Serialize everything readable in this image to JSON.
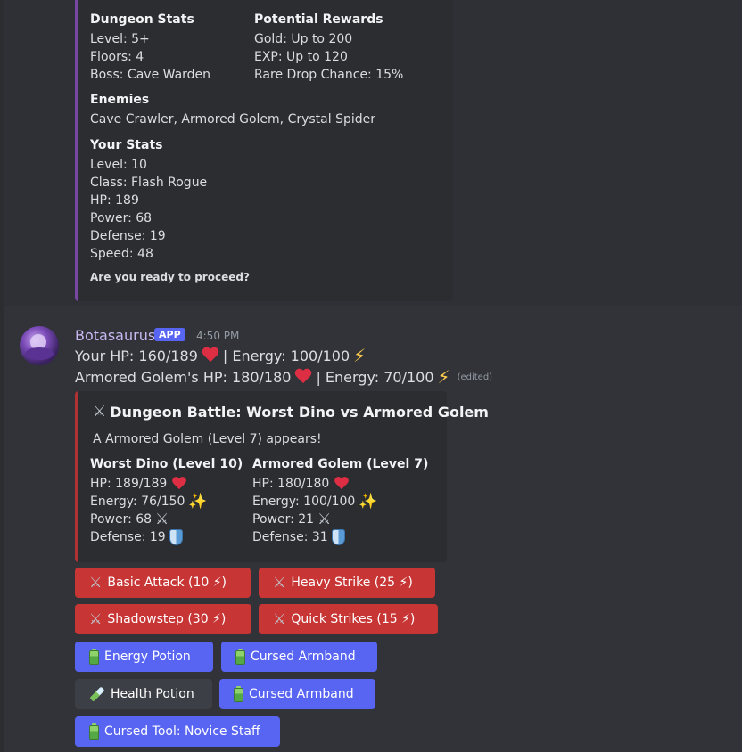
{
  "top_embed": {
    "clipped_text": "Dungeon Stats",
    "dungeon_stats": {
      "title": "Dungeon Stats",
      "lines": [
        "Level: 5+",
        "Floors: 4",
        "Boss: Cave Warden"
      ]
    },
    "rewards": {
      "title": "Potential Rewards",
      "lines": [
        "Gold: Up to 200",
        "EXP: Up to 120",
        "Rare Drop Chance: 15%"
      ]
    },
    "enemies": {
      "title": "Enemies",
      "text": "Cave Crawler, Armored Golem, Crystal Spider"
    },
    "your_stats": {
      "title": "Your Stats",
      "lines": [
        "Level: 10",
        "Class: Flash Rogue",
        "HP: 189",
        "Power: 68",
        "Defense: 19",
        "Speed: 48"
      ]
    },
    "footer": "Are you ready to proceed?"
  },
  "message": {
    "username": "Botasaurus",
    "badge": "APP",
    "timestamp": "4:50 PM",
    "line1_hp": "Your HP: 160/189",
    "line1_energy": "| Energy: 100/100",
    "line2_hp": "Armored Golem's HP: 180/180",
    "line2_energy": "| Energy: 70/100",
    "edited": "(edited)"
  },
  "battle_embed": {
    "title": "Dungeon Battle: Worst Dino vs Armored Golem",
    "description": "A Armored Golem (Level 7) appears!",
    "player": {
      "name": "Worst Dino (Level 10)",
      "hp": "HP: 189/189",
      "energy": "Energy: 76/150",
      "power": "Power: 68",
      "defense": "Defense: 19"
    },
    "enemy": {
      "name": "Armored Golem (Level 7)",
      "hp": "HP: 180/180",
      "energy": "Energy: 100/100",
      "power": "Power: 21",
      "defense": "Defense: 31"
    }
  },
  "buttons": {
    "basic_attack": "Basic Attack (10 ⚡)",
    "heavy_strike": "Heavy Strike (25 ⚡)",
    "shadowstep": "Shadowstep (30 ⚡)",
    "quick_strikes": "Quick Strikes (15 ⚡)",
    "energy_potion": "Energy Potion",
    "cursed_armband_1": "Cursed Armband",
    "health_potion": "Health Potion",
    "cursed_armband_2": "Cursed Armband",
    "cursed_tool": "Cursed Tool: Novice Staff"
  },
  "colors": {
    "background": "#313338",
    "embed_bg": "#2b2d31",
    "top_embed_accent": "#7847a3",
    "battle_embed_accent": "#b03232",
    "danger_button": "#c73535",
    "primary_button": "#5865f2",
    "secondary_button": "#3c3f45"
  },
  "icons": {
    "heart": "heart-icon",
    "energy": "lightning-icon",
    "sparkles": "sparkles-icon",
    "swords": "crossed-swords-icon",
    "shield": "shield-icon",
    "battery": "battery-icon",
    "potion": "test-tube-icon"
  }
}
